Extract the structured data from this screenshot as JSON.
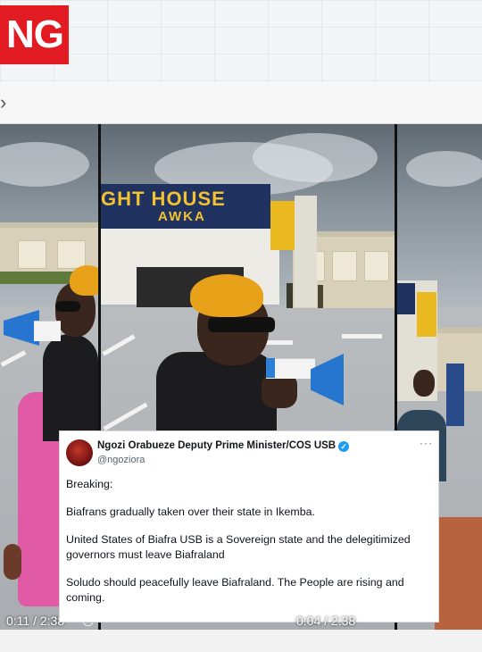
{
  "brand": {
    "text": "NG",
    "color": "#e21b23"
  },
  "browser": {
    "back_icon": "chevron-right-icon",
    "back_glyph": "›"
  },
  "video": {
    "left_time": "0:11 / 2:38",
    "right_time": "0:04 / 2:38",
    "sign_line1": "GHT HOUSE",
    "sign_line2": "AWKA",
    "speaker_icon": "speaker-icon"
  },
  "tweet": {
    "name": "Ngozi Orabueze Deputy Prime Minister/COS USB",
    "handle": "@ngoziora",
    "verified_icon": "verified-badge-icon",
    "more_icon": "more-icon",
    "more_glyph": "···",
    "paragraphs": [
      "Breaking:",
      "Biafrans gradually taken over their state in Ikemba.",
      "United States of Biafra USB is a Sovereign state and the delegitimized governors must leave Biafraland",
      "Soludo should peacefully leave Biafraland. The People are rising and coming."
    ]
  },
  "colors": {
    "accent_blue": "#1d9bf0",
    "beret": "#e7a21a",
    "megaphone": "#2b7fd6"
  }
}
